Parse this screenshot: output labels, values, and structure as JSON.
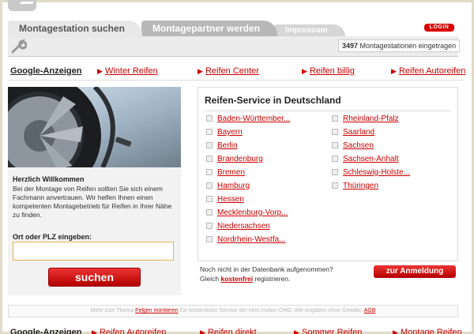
{
  "tabs": [
    {
      "label": "Montagestation suchen"
    },
    {
      "label": "Montagepartner werden"
    },
    {
      "label": "Impressum"
    }
  ],
  "login_label": "LOGIN",
  "station_count": {
    "number": "3497",
    "text": "Montagestationen eingetragen"
  },
  "ads_top": {
    "label": "Google-Anzeigen",
    "links": [
      "Winter Reifen",
      "Reifen Center",
      "Reifen billig",
      "Reifen Autoreifen"
    ]
  },
  "welcome": {
    "title": "Herzlich Willkommen",
    "text": "Bei der Montage von Reifen sollten Sie sich einem Fachmann anvertrauen. Wir helfen Ihnen einen kompetenten Montagebetrieb für Reifen in Ihrer Nähe zu finden."
  },
  "search": {
    "label": "Ort oder PLZ eingeben:",
    "value": "",
    "button": "suchen"
  },
  "service": {
    "title": "Reifen-Service in Deutschland",
    "states_left": [
      "Baden-Württember...",
      "Bayern",
      "Berlin",
      "Brandenburg",
      "Bremen",
      "Hamburg",
      "Hessen",
      "Mecklenburg-Vorp...",
      "Niedersachsen",
      "Nordrhein-Westfa..."
    ],
    "states_right": [
      "Rheinland-Pfalz",
      "Saarland",
      "Sachsen",
      "Sachsen-Anhalt",
      "Schleswig-Holste...",
      "Thüringen"
    ]
  },
  "register": {
    "line1": "Noch nicht in der Datenbank aufgenommen?",
    "line2_pre": "Gleich",
    "line2_link": "kostenfrei",
    "line2_post": "registrieren.",
    "button": "zur Anmeldung"
  },
  "footer": {
    "pre": "Mehr zum Thema",
    "link": "Felgen montieren",
    "mid": "Ein kostenloser Service der next.motion OHG. Alle Angaben ohne Gewähr.",
    "agb": "AGB"
  },
  "ads_bottom": {
    "label": "Google-Anzeigen",
    "links": [
      "Reifen Autoreifen",
      "Reifen direkt",
      "Sommer Reifen",
      "Montage Reifen"
    ]
  },
  "colors": {
    "accent": "#cc0000",
    "tab_bg": "#e8e8e8"
  },
  "icons": [
    "wrench-icon",
    "arrow-right-icon",
    "checkbox-icon"
  ]
}
